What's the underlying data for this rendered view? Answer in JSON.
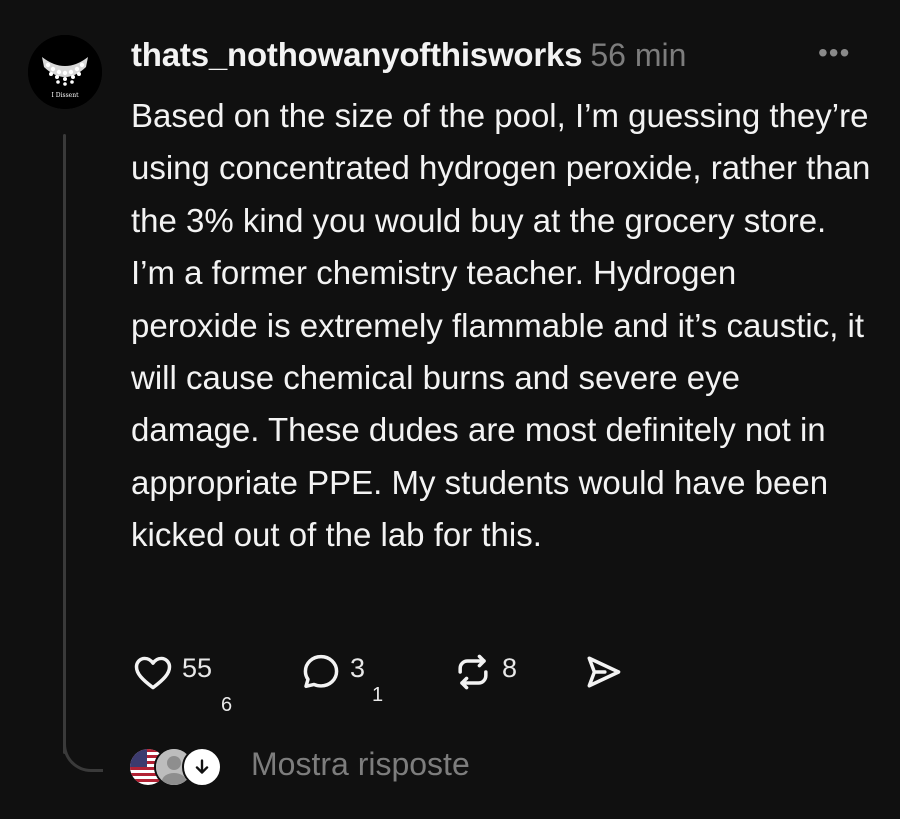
{
  "post": {
    "username": "thats_nothowanyofthisworks",
    "time": "56 min",
    "more_label": "•••",
    "avatar_caption": "I Dissent",
    "body": "Based on the size of the pool, I’m guessing they’re using concentrated hydrogen peroxide, rather than the 3% kind you would buy at the grocery store. I’m a former chemistry teacher. Hydrogen peroxide is extremely flammable and it’s caustic, it will cause chemical burns and severe eye damage. These dudes are most definitely not in appropriate PPE. My students would have been kicked out of the lab for this."
  },
  "actions": {
    "like": {
      "icon": "heart-icon",
      "count": "55",
      "sub": "6"
    },
    "reply": {
      "icon": "comment-bubble-icon",
      "count": "3",
      "sub": "1"
    },
    "repost": {
      "icon": "repost-icon",
      "count": "8"
    },
    "share": {
      "icon": "send-icon"
    }
  },
  "replies": {
    "label": "Mostra risposte",
    "icon": "arrow-down-icon"
  },
  "colors": {
    "background": "#101010",
    "text": "#f3f3f3",
    "muted": "#7d7d7d",
    "thread_line": "#3a3a3a"
  }
}
